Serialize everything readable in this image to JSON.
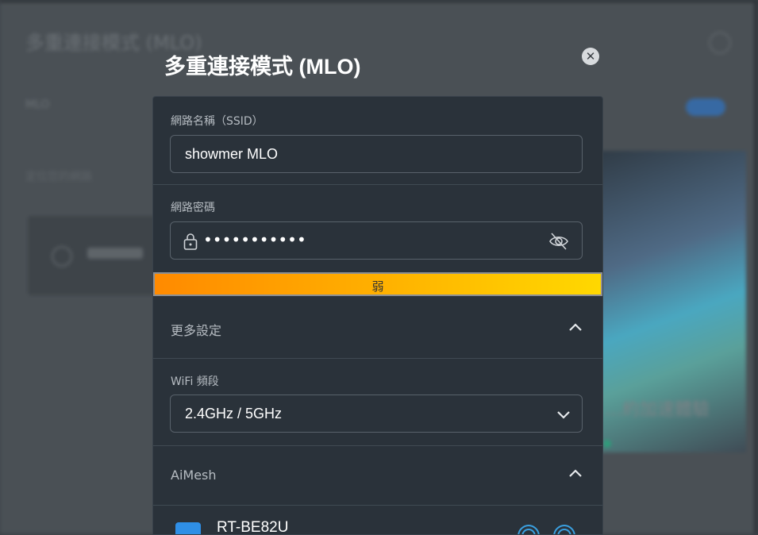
{
  "background": {
    "title": "多重連接模式 (MLO)",
    "mlo_label": "MLO",
    "subtitle": "定位您的網路",
    "card_label": "新增節點",
    "banner_text": "…約加速體驗"
  },
  "dialog": {
    "title": "多重連接模式 (MLO)",
    "close_icon": "close-icon",
    "ssid": {
      "label": "網路名稱（SSID）",
      "value": "showmer MLO"
    },
    "password": {
      "label": "網路密碼",
      "value": "•••••••••••",
      "strength_label": "弱",
      "show_icon": "eye-off-icon"
    },
    "more_settings": {
      "label": "更多設定",
      "expanded": true
    },
    "wifi_band": {
      "label": "WiFi 頻段",
      "value": "2.4GHz / 5GHz"
    },
    "aimesh": {
      "label": "AiMesh",
      "expanded": true,
      "devices": [
        {
          "name": "RT-BE82U",
          "checked": true
        }
      ]
    }
  },
  "colors": {
    "dialog_bg": "#2a323a",
    "accent_blue": "#2f8fe6",
    "strength_start": "#ff8a00",
    "strength_end": "#ffd800"
  }
}
